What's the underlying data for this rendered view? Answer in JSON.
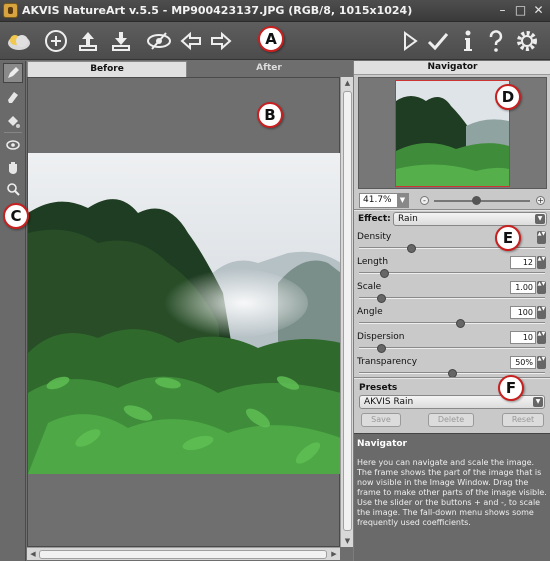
{
  "window": {
    "title": "AKVIS NatureArt v.5.5 - MP900423137.JPG (RGB/8, 1015x1024)",
    "controls": [
      "–",
      "□",
      "✕"
    ]
  },
  "toolbar": {
    "left_icons": [
      "open-image-icon",
      "save-icon",
      "print-icon",
      "load-preset-icon",
      "save-preset-icon",
      "settings-eye-icon",
      "undo-icon",
      "redo-icon"
    ],
    "right_icons": [
      "run-icon",
      "apply-icon",
      "info-icon",
      "help-icon",
      "preferences-icon"
    ]
  },
  "left_tools": [
    "direction-pencil-icon",
    "eraser-icon",
    "fill-bucket-icon",
    "eye-dropper-icon",
    "hand-icon",
    "zoom-icon"
  ],
  "tabs": {
    "before": "Before",
    "after": "After"
  },
  "navigator": {
    "title": "Navigator",
    "zoom_value": "41.7%",
    "zoom_level": 0.42
  },
  "effect": {
    "label": "Effect:",
    "value": "Rain"
  },
  "params": [
    {
      "label": "Density",
      "value": "",
      "fraction": 0.27
    },
    {
      "label": "Length",
      "value": "12",
      "fraction": 0.12
    },
    {
      "label": "Scale",
      "value": "1.00",
      "fraction": 0.1
    },
    {
      "label": "Angle",
      "value": "100",
      "fraction": 0.55
    },
    {
      "label": "Dispersion",
      "value": "10",
      "fraction": 0.1
    },
    {
      "label": "Transparency",
      "value": "50%",
      "fraction": 0.5
    }
  ],
  "presets": {
    "title": "Presets",
    "value": "AKVIS Rain",
    "save": "Save",
    "delete": "Delete",
    "reset": "Reset"
  },
  "help": {
    "title": "Navigator",
    "text": "Here you can navigate and scale the image. The frame shows the part of the image that is now visible in the Image Window. Drag the frame to make other parts of the image visible. Use the slider or the buttons + and -, to scale the image. The fall-down menu shows some frequently used coefficients."
  },
  "markers": {
    "a": "A",
    "b": "B",
    "c": "C",
    "d": "D",
    "e": "E",
    "f": "F"
  },
  "colors": {
    "marker_border": "#c81f1f",
    "panel_bg": "#c9c9c9",
    "toolbar_bg": "#555555"
  }
}
